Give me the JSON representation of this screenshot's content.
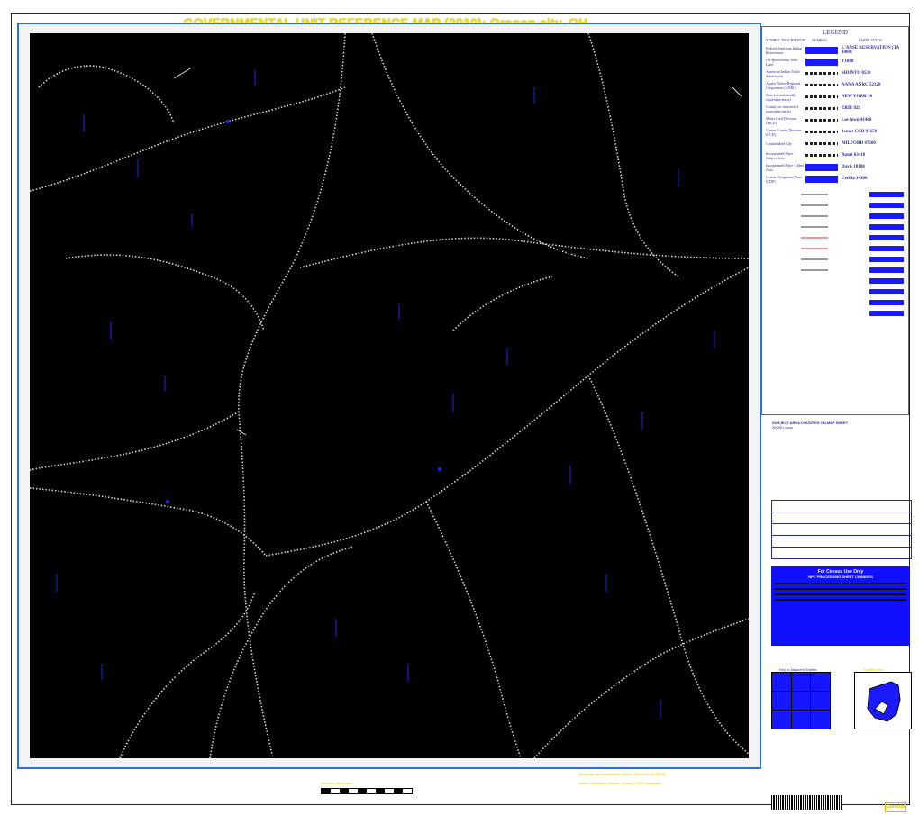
{
  "title": "GOVERNMENTAL UNIT REFERENCE MAP (2010): Oregon city, OH",
  "legend": {
    "title": "LEGEND",
    "headers": [
      "SYMBOL DESCRIPTION",
      "SYMBOL",
      "LABEL STYLE"
    ],
    "rows": [
      {
        "desc": "Federal American Indian Reservation",
        "label": "L'ANSE RESERVATION (TA 1880)"
      },
      {
        "desc": "Off-Reservation Trust Land",
        "label": "T1880"
      },
      {
        "desc": "American Indian Tribal Subdivision",
        "label": "SHONTO 0530"
      },
      {
        "desc": "Alaska Native Regional Corporation (ANRC)",
        "label": "NANA ANRC 52120"
      },
      {
        "desc": "State (or statistically equivalent entity)",
        "label": "NEW YORK 36"
      },
      {
        "desc": "County (or statistically equivalent entity)",
        "label": "ERIE 029"
      },
      {
        "desc": "Minor Civil Division (MCD)",
        "label": "Lee town 41460"
      },
      {
        "desc": "Census County Division (CCD)",
        "label": "Jemez CCD 91650"
      },
      {
        "desc": "Consolidated City",
        "label": "MILFORD 47500"
      },
      {
        "desc": "Incorporated Place / Subject Area",
        "label": "Rome 63418"
      },
      {
        "desc": "Incorporated Place / Other Area",
        "label": "Davis 18100"
      },
      {
        "desc": "Census Designated Place (CDP)",
        "label": "Cecilia 14380"
      }
    ]
  },
  "subject_area": {
    "heading": "SUBJECT AREA COUNTIES ON MAP SHEET",
    "county": "39095 Lucas"
  },
  "census_box": {
    "title": "For Census Use Only",
    "subtitle": "NPC PROCESSING SHEET CHANGES"
  },
  "adjacent_label": "Key to Adjacent Sheets",
  "locator_label": "Subject Area",
  "footer": {
    "scale_note": "Geodetic Map Data",
    "release_line": "Boundary and Annexation Survey (BAS) for 2010/2011",
    "source_line": "Base Information Source: Census TIGER database"
  },
  "colors": {
    "map_background": "#000000",
    "frame": "#2a6edc",
    "title": "#f5e400",
    "symbol_blue": "#1a1aff"
  }
}
